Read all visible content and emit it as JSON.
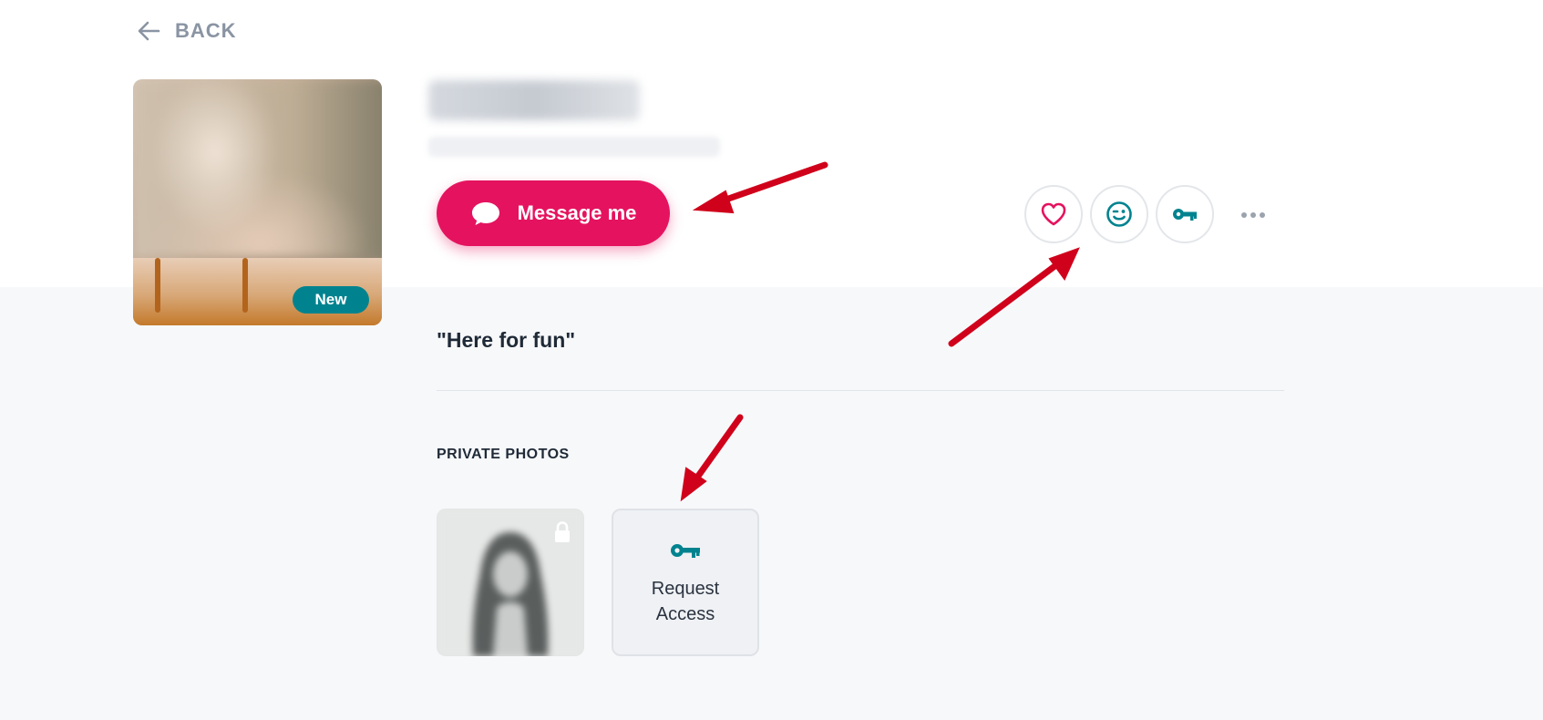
{
  "header": {
    "back_label": "BACK"
  },
  "profile": {
    "badge": "New",
    "message_button_label": "Message me",
    "tagline": "\"Here for fun\""
  },
  "actions": [
    {
      "name": "favorite",
      "icon": "heart-icon",
      "color": "#e5135f"
    },
    {
      "name": "wink",
      "icon": "wink-icon",
      "color": "#00838f"
    },
    {
      "name": "key-access",
      "icon": "key-icon",
      "color": "#00838f"
    },
    {
      "name": "more",
      "icon": "more-dots-icon",
      "color": "#9aa3ae"
    }
  ],
  "private_photos": {
    "title": "PRIVATE PHOTOS",
    "request_label": "Request Access"
  },
  "colors": {
    "accent_pink": "#e5135f",
    "accent_teal": "#00838f",
    "annotation_red": "#d0021b"
  }
}
